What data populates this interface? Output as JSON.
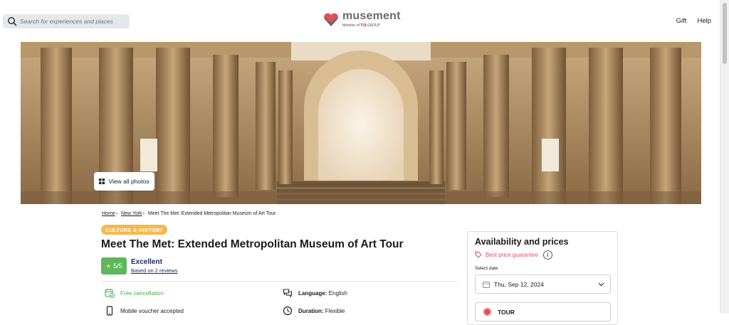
{
  "header": {
    "search_placeholder": "Search for experiences and places",
    "logo_text": "musement",
    "logo_member_prefix": "Member of",
    "logo_member_brand": "TUI",
    "logo_member_suffix": "GROUP",
    "links": [
      "Gift",
      "Help"
    ]
  },
  "hero": {
    "view_all_label": "View all photos"
  },
  "breadcrumb": {
    "items": [
      "Home",
      "New York"
    ],
    "current": "Meet The Met: Extended Metropolitan Museum of Art Tour"
  },
  "category_badge": "CULTURE & HISTORY",
  "title": "Meet The Met: Extended Metropolitan Museum of Art Tour",
  "rating": {
    "score": "5/5",
    "label": "Excellent",
    "reviews": "Based on 2 reviews"
  },
  "features": {
    "cancellation": "Free cancellation",
    "voucher": "Mobile voucher accepted",
    "language_label": "Language:",
    "language_value": "English",
    "duration_label": "Duration:",
    "duration_value": "Flexible"
  },
  "availability": {
    "title": "Availability and prices",
    "guarantee": "Best price guarantee",
    "info_glyph": "i",
    "select_date_label": "Select date",
    "date_value": "Thu, Sep 12, 2024",
    "option_label": "TOUR"
  },
  "colors": {
    "brand_red": "#e4505b",
    "badge_orange": "#f7b84a",
    "rating_green": "#5cb85c",
    "link_navy": "#1b2a6b"
  }
}
